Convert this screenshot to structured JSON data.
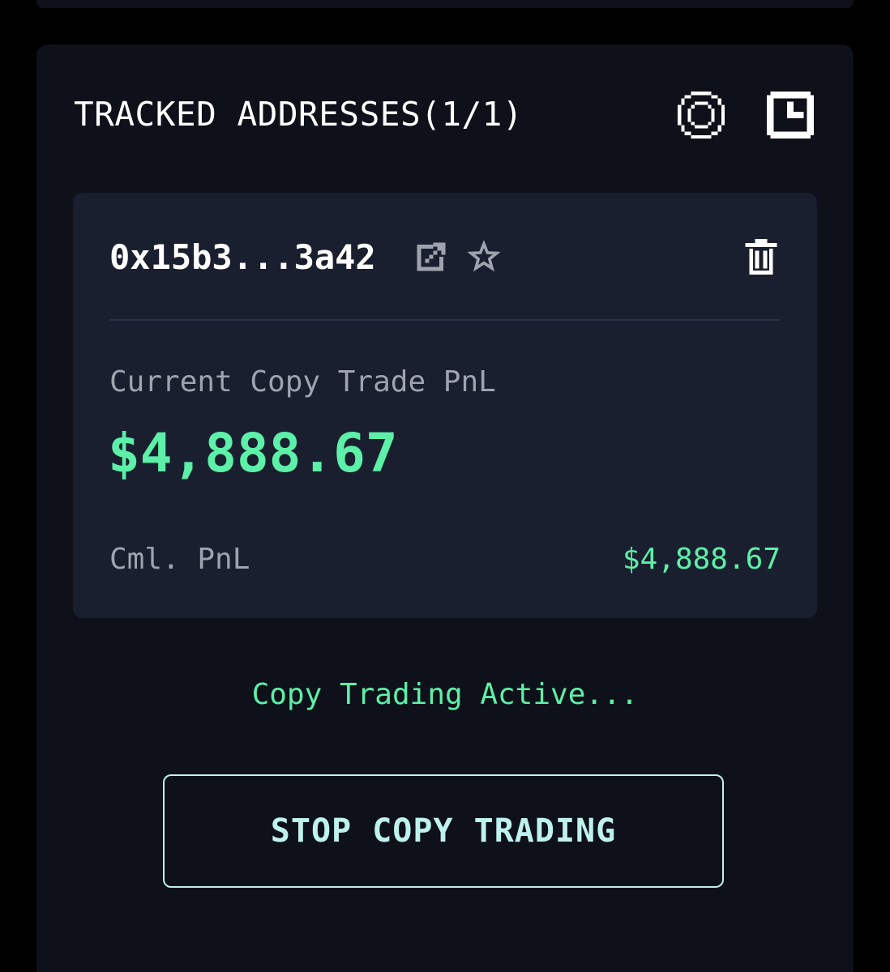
{
  "panel": {
    "title": "TRACKED ADDRESSES(1/1)",
    "icons": {
      "settings": "settings-icon",
      "history": "clock-icon"
    }
  },
  "card": {
    "address": "0x15b3...3a42",
    "icons": {
      "external": "external-link-icon",
      "favorite": "star-icon",
      "delete": "trash-icon"
    },
    "current_pnl_label": "Current Copy Trade PnL",
    "current_pnl_value": "$4,888.67",
    "cml_pnl_label": "Cml. PnL",
    "cml_pnl_value": "$4,888.67"
  },
  "status": {
    "text": "Copy Trading Active..."
  },
  "actions": {
    "stop_label": "STOP COPY TRADING"
  },
  "colors": {
    "background": "#000000",
    "panel": "#0e1119",
    "card": "#1a1f2f",
    "accent_green": "#5cf0a8",
    "button_border": "#bff1ee",
    "muted_text": "#9ea3ae"
  }
}
